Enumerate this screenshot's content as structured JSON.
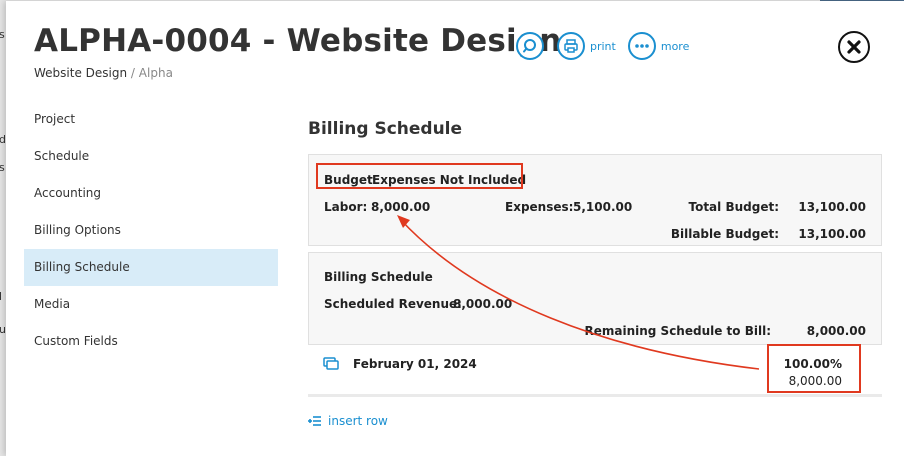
{
  "background_glyphs": [
    "s",
    "d",
    "s",
    "l",
    "u"
  ],
  "header": {
    "title": "ALPHA-0004 - Website Design",
    "breadcrumb_project": "Website Design",
    "breadcrumb_sep": "/",
    "breadcrumb_sub": "Alpha",
    "print_label": "print",
    "more_label": "more",
    "icons": {
      "search": "search-icon",
      "print": "print-icon",
      "more": "more-icon",
      "close": "close-icon"
    }
  },
  "nav": {
    "items": [
      "Project",
      "Schedule",
      "Accounting",
      "Billing Options",
      "Billing Schedule",
      "Media",
      "Custom Fields"
    ],
    "active_index": 4
  },
  "main": {
    "section_title": "Billing Schedule",
    "budget": {
      "heading": "Budget",
      "heading_note": "Expenses Not Included",
      "labor_label": "Labor:",
      "labor_value": "8,000.00",
      "expenses_label": "Expenses:",
      "expenses_value": "5,100.00",
      "total_label": "Total Budget:",
      "total_value": "13,100.00",
      "billable_label": "Billable Budget:",
      "billable_value": "13,100.00"
    },
    "schedule": {
      "heading": "Billing Schedule",
      "revenue_label": "Scheduled Revenue:",
      "revenue_value": "8,000.00",
      "remaining_label": "Remaining Schedule to Bill:",
      "remaining_value": "8,000.00"
    },
    "rows": [
      {
        "date": "February 01, 2024",
        "percent": "100.00%",
        "amount": "8,000.00"
      }
    ],
    "insert_row_label": "insert row"
  },
  "colors": {
    "accent": "#1a8fd0",
    "highlight": "#e0391f",
    "active_nav": "#d8ecf8"
  }
}
